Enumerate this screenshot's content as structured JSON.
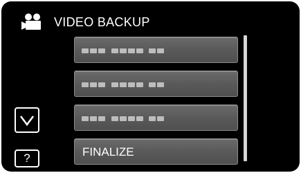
{
  "header": {
    "title": "VIDEO BACKUP",
    "icon": "movie-camera-icon"
  },
  "menu": {
    "items": [
      {
        "label": "",
        "placeholder": "dotted-placeholder-text"
      },
      {
        "label": "",
        "placeholder": "dotted-placeholder-text"
      },
      {
        "label": "",
        "placeholder": "dotted-placeholder-text"
      },
      {
        "label": "FINALIZE"
      }
    ]
  },
  "controls": {
    "down_icon": "chevron-down-icon",
    "help_label": "?"
  },
  "colors": {
    "background": "#000000",
    "button_fill": "#5a5a5a",
    "button_border": "#8b8b8b",
    "text": "#ffffff"
  }
}
